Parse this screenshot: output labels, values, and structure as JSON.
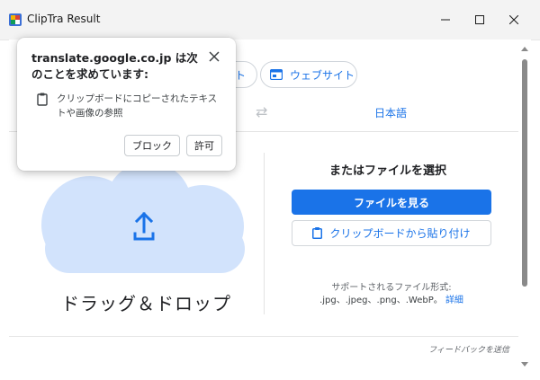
{
  "window": {
    "title": "ClipTra Result"
  },
  "toolbar": {
    "tab_partial_label": "ト",
    "website_label": "ウェブサイト"
  },
  "languages": {
    "target": "日本語"
  },
  "upload": {
    "drag_drop_label": "ドラッグ＆ドロップ",
    "or_choose_label": "またはファイルを選択",
    "browse_button": "ファイルを見る",
    "paste_button": "クリップボードから貼り付け",
    "supported_label": "サポートされるファイル形式:",
    "formats": ".jpg、.jpeg、.png、.WebP。",
    "details_link": "詳細"
  },
  "footer": {
    "feedback": "フィードバックを送信"
  },
  "permission_popup": {
    "title": "translate.google.co.jp は次のことを求めています:",
    "permission_text": "クリップボードにコピーされたテキストや画像の参照",
    "block_button": "ブロック",
    "allow_button": "許可"
  },
  "colors": {
    "accent": "#1a73e8",
    "cloud": "#d2e3fc"
  }
}
